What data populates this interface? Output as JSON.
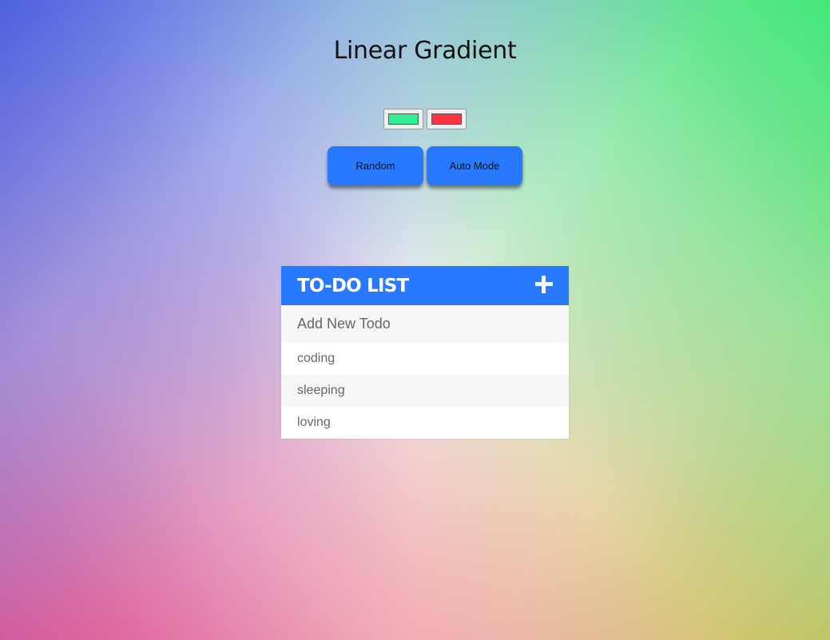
{
  "page": {
    "title": "Linear Gradient"
  },
  "colors": {
    "color1": "#33ee99",
    "color2": "#ff3344",
    "accent": "#2979ff"
  },
  "buttons": {
    "random_label": "Random",
    "auto_mode_label": "Auto Mode"
  },
  "todo": {
    "header_title": "TO-DO LIST",
    "add_icon": "plus-icon",
    "input_placeholder": "Add New Todo",
    "items": [
      {
        "label": "coding"
      },
      {
        "label": "sleeping"
      },
      {
        "label": "loving"
      }
    ]
  }
}
